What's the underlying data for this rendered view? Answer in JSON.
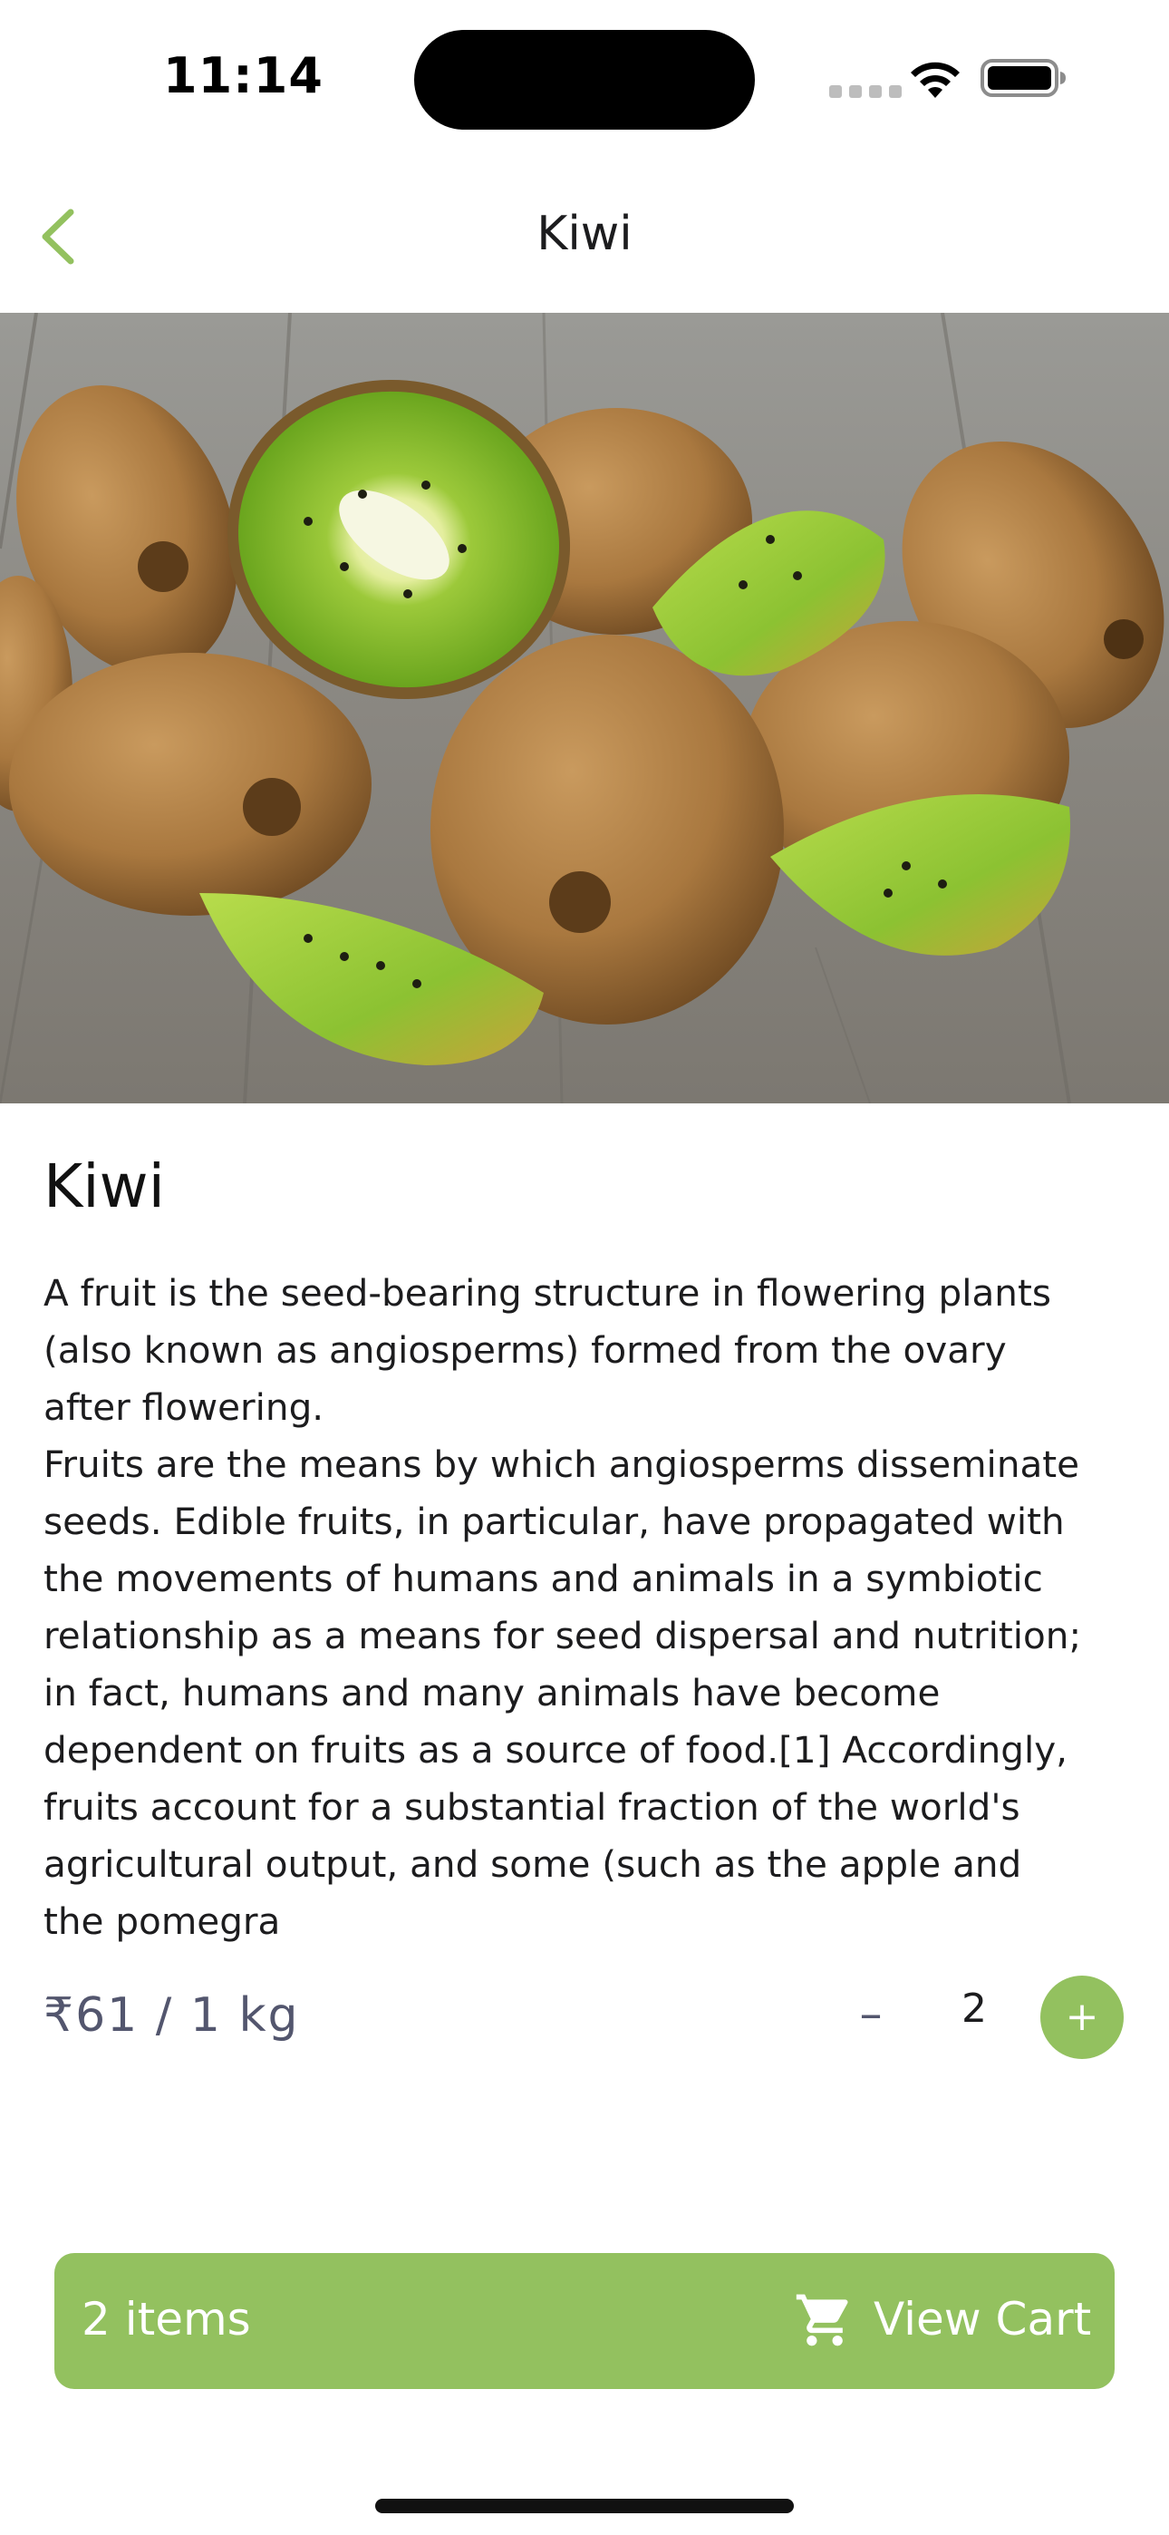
{
  "status_bar": {
    "time": "11:14"
  },
  "nav": {
    "title": "Kiwi",
    "back_icon": "chevron-left-icon"
  },
  "hero_image": {
    "subject": "kiwi-fruit-photo"
  },
  "product": {
    "name": "Kiwi",
    "description": "A fruit is the seed-bearing structure in flowering plants\n(also known as angiosperms) formed from the ovary\nafter flowering.\nFruits are the means by which angiosperms disseminate\nseeds. Edible fruits, in particular, have propagated with\nthe movements of humans and animals in a symbiotic\nrelationship as a means for seed dispersal and nutrition;\nin fact, humans and many animals have become\ndependent on fruits as a source of food.[1] Accordingly,\nfruits account for a substantial fraction of the world's\nagricultural output, and some (such as the apple and\nthe pomegra",
    "price": "₹61 / 1 kg"
  },
  "quantity": {
    "minus_label": "–",
    "value": "2",
    "plus_label": "+"
  },
  "cart": {
    "count_label": "2 items",
    "action_label": "View Cart",
    "icon": "cart-icon"
  },
  "colors": {
    "accent": "#93c15f",
    "price_text": "#53566e"
  }
}
